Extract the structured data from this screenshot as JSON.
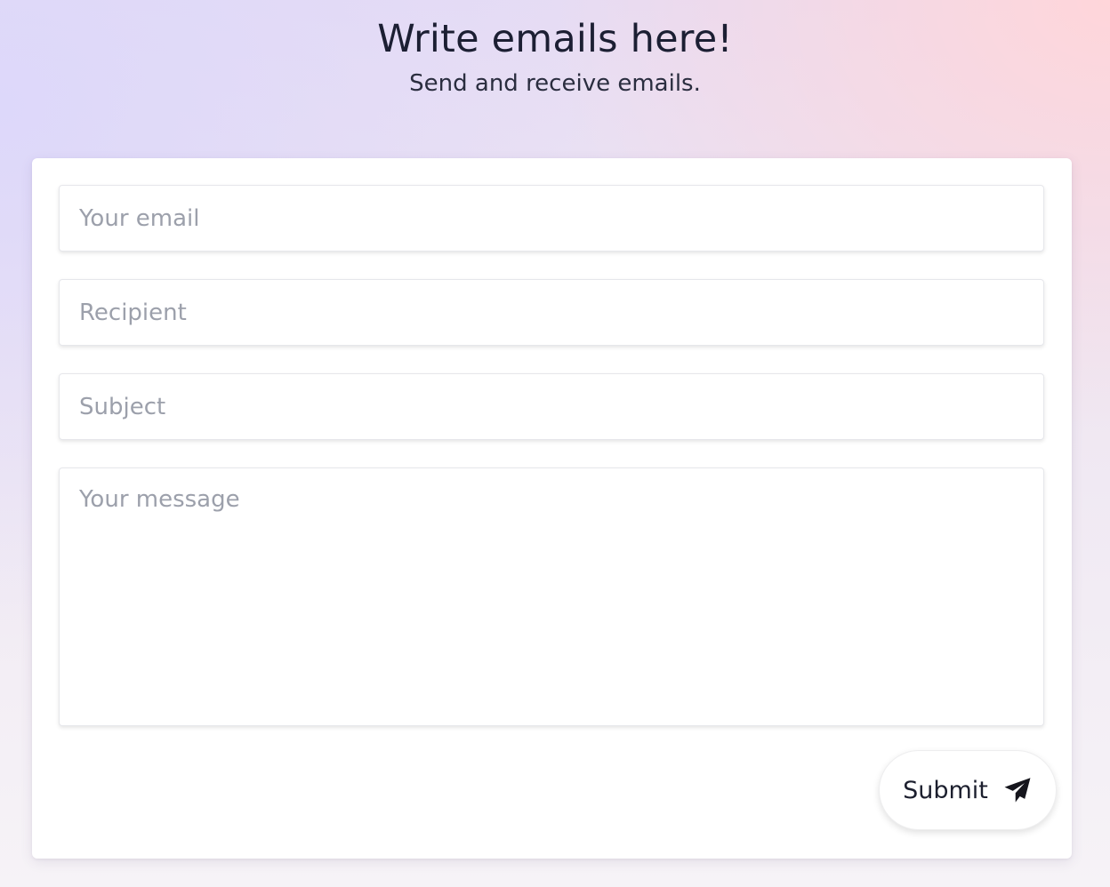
{
  "header": {
    "title": "Write emails here!",
    "subtitle": "Send and receive emails."
  },
  "form": {
    "email_placeholder": "Your email",
    "recipient_placeholder": "Recipient",
    "subject_placeholder": "Subject",
    "message_placeholder": "Your message",
    "submit_label": "Submit",
    "submit_icon": "paper-plane-icon"
  },
  "colors": {
    "background_left": "#ddd8fa",
    "background_right": "#ffd6da",
    "card": "#ffffff",
    "placeholder": "#9ca0ab",
    "text": "#1c1f33"
  }
}
